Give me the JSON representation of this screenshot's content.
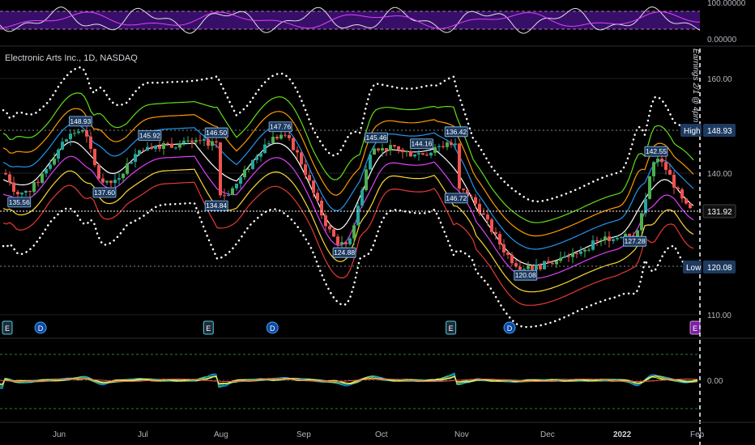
{
  "header": {
    "title": "Electronic Arts Inc., 1D, NASDAQ",
    "earnings_note": "Earnings 2/1 @ 4pm"
  },
  "top_panel": {
    "ticks": [
      "100.00000",
      "0.00000"
    ]
  },
  "price_axis": {
    "ticks": [
      "160.00",
      "140.00",
      "110.00"
    ],
    "high_label": "High",
    "high_value": "148.93",
    "last_value": "131.92",
    "low_label": "Low",
    "low_value": "120.08"
  },
  "bottom_panel": {
    "ticks": [
      "0.00"
    ]
  },
  "time_axis": {
    "labels": [
      "Jun",
      "Jul",
      "Aug",
      "Sep",
      "Oct",
      "Nov",
      "Dec",
      "2022",
      "Feb"
    ]
  },
  "annotations": [
    "135.56",
    "148.93",
    "137.60",
    "145.92",
    "146.50",
    "134.84",
    "147.76",
    "124.88",
    "145.46",
    "144.16",
    "136.42",
    "146.72",
    "120.08",
    "127.28",
    "142.55"
  ],
  "event_markers": [
    "E",
    "D",
    "E",
    "D",
    "E",
    "D",
    "E"
  ],
  "colors": {
    "background": "#000000",
    "up_candle": "#26a69a",
    "up_candle_bright": "#4caf50",
    "down_candle": "#ef5350",
    "band_dots": "#ffffff",
    "purple_band": "#6a1b9a",
    "label_blue": "#1e3a5f",
    "event_e": "#7b1fa2",
    "event_d": "#1565c0"
  },
  "chart_data": {
    "type": "candlestick",
    "ylim": [
      104,
      168
    ],
    "x_range": [
      "2021-05-18",
      "2022-02-01"
    ],
    "labeled_points": [
      {
        "date": "2021-05-24",
        "value": 135.56,
        "kind": "low"
      },
      {
        "date": "2021-06-16",
        "value": 148.93,
        "kind": "high"
      },
      {
        "date": "2021-06-25",
        "value": 137.6,
        "kind": "low"
      },
      {
        "date": "2021-07-12",
        "value": 145.92,
        "kind": "high"
      },
      {
        "date": "2021-08-06",
        "value": 146.5,
        "kind": "high"
      },
      {
        "date": "2021-08-06",
        "value": 134.84,
        "kind": "low"
      },
      {
        "date": "2021-08-30",
        "value": 147.76,
        "kind": "high"
      },
      {
        "date": "2021-09-23",
        "value": 124.88,
        "kind": "low"
      },
      {
        "date": "2021-10-05",
        "value": 145.46,
        "kind": "high"
      },
      {
        "date": "2021-10-22",
        "value": 144.16,
        "kind": "high"
      },
      {
        "date": "2021-11-04",
        "value": 146.72,
        "kind": "high"
      },
      {
        "date": "2021-11-04",
        "value": 136.42,
        "kind": "low"
      },
      {
        "date": "2021-11-30",
        "value": 120.08,
        "kind": "low"
      },
      {
        "date": "2022-01-10",
        "value": 127.28,
        "kind": "low"
      },
      {
        "date": "2022-01-18",
        "value": 142.55,
        "kind": "high"
      }
    ],
    "period_high": 148.93,
    "period_low": 120.08,
    "last_price": 131.92
  }
}
